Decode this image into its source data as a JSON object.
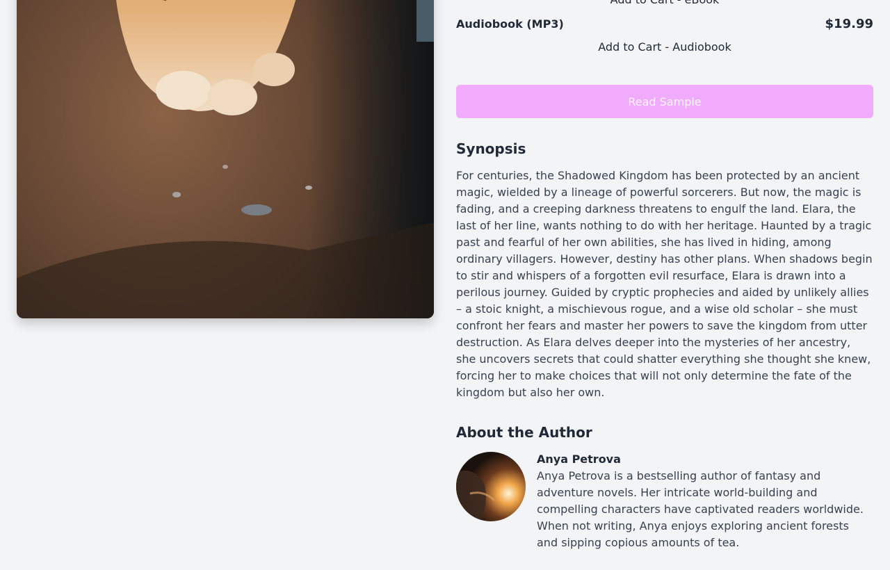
{
  "purchase": {
    "ebook_cart_label": "Add to Cart - eBook",
    "audiobook_format": "Audiobook (MP3)",
    "audiobook_price": "$19.99",
    "audiobook_cart_label": "Add to Cart - Audiobook",
    "sample_label": "Read Sample"
  },
  "synopsis": {
    "title": "Synopsis",
    "text": "For centuries, the Shadowed Kingdom has been protected by an ancient magic, wielded by a lineage of powerful sorcerers. But now, the magic is fading, and a creeping darkness threatens to engulf the land. Elara, the last of her line, wants nothing to do with her heritage. Haunted by a tragic past and fearful of her own abilities, she has lived in hiding, among ordinary villagers. However, destiny has other plans. When shadows begin to stir and whispers of a forgotten evil resurface, Elara is drawn into a perilous journey. Guided by cryptic prophecies and aided by unlikely allies – a stoic knight, a mischievous rogue, and a wise old scholar – she must confront her fears and master her powers to save the kingdom from utter destruction. As Elara delves deeper into the mysteries of her ancestry, she uncovers secrets that could shatter everything she thought she knew, forcing her to make choices that will not only determine the fate of the kingdom but also her own."
  },
  "author": {
    "section_title": "About the Author",
    "name": "Anya Petrova",
    "bio": "Anya Petrova is a bestselling author of fantasy and adventure novels. Her intricate world-building and compelling characters have captivated readers worldwide. When not writing, Anya enjoys exploring ancient forests and sipping copious amounts of tea."
  },
  "colors": {
    "sample_button_bg": "#f0abfc",
    "page_bg": "#f3f4f6",
    "heading": "#1f2937"
  }
}
